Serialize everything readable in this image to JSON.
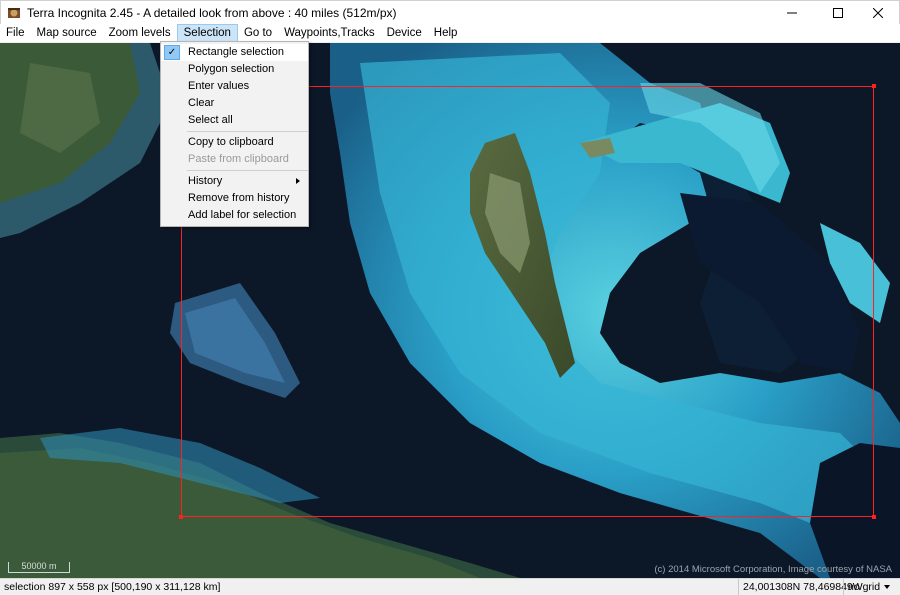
{
  "window": {
    "title": "Terra Incognita 2.45 - A detailed look from above : 40 miles (512m/px)"
  },
  "menubar": {
    "items": [
      {
        "label": "File"
      },
      {
        "label": "Map source"
      },
      {
        "label": "Zoom levels"
      },
      {
        "label": "Selection",
        "open": true
      },
      {
        "label": "Go to"
      },
      {
        "label": "Waypoints,Tracks"
      },
      {
        "label": "Device"
      },
      {
        "label": "Help"
      }
    ]
  },
  "selection_menu": {
    "rectangle_selection": "Rectangle selection",
    "polygon_selection": "Polygon selection",
    "enter_values": "Enter values",
    "clear": "Clear",
    "select_all": "Select all",
    "copy_to_clipboard": "Copy to clipboard",
    "paste_from_clipboard": "Paste from clipboard",
    "history": "History",
    "remove_from_history": "Remove from history",
    "add_label_for_selection": "Add label for selection",
    "check_mark": "✓"
  },
  "map": {
    "scale_label": "50000 m",
    "copyright": "(c) 2014 Microsoft Corporation, Image courtesy of NASA",
    "selection_color": "#ff2020"
  },
  "statusbar": {
    "selection_info": "selection 897 x 558 px [500,190 x 311,128 km]",
    "coordinates": "24,001308N 78,469849W",
    "grid_mode": "no grid"
  },
  "icons": {
    "app": "globe-app-icon",
    "minimize": "minimize-icon",
    "maximize": "maximize-icon",
    "close": "close-icon",
    "submenu": "submenu-arrow-icon",
    "check": "check-icon"
  }
}
